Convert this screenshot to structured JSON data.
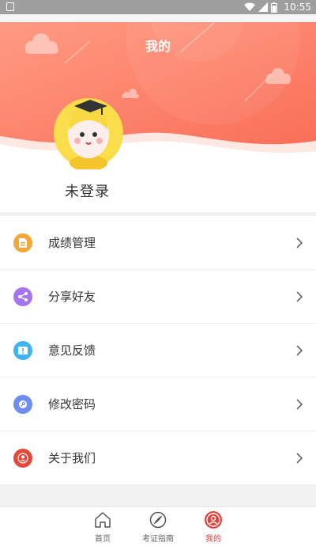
{
  "status_bar": {
    "time": "10:55"
  },
  "header": {
    "title": "我的",
    "login_text": "未登录"
  },
  "menu": [
    {
      "label": "成绩管理",
      "icon": "document-icon",
      "color": "#f5a63b"
    },
    {
      "label": "分享好友",
      "icon": "share-icon",
      "color": "#a575f0"
    },
    {
      "label": "意见反馈",
      "icon": "feedback-icon",
      "color": "#3db4ee"
    },
    {
      "label": "修改密码",
      "icon": "key-icon",
      "color": "#6f8cf0"
    },
    {
      "label": "关于我们",
      "icon": "user-icon",
      "color": "#e24a3d"
    }
  ],
  "tabbar": {
    "home": "首页",
    "guide": "考证指南",
    "mine": "我的",
    "active_color": "#e2413c"
  },
  "colors": {
    "header_start": "#ff8f78",
    "header_end": "#fb6e57"
  }
}
